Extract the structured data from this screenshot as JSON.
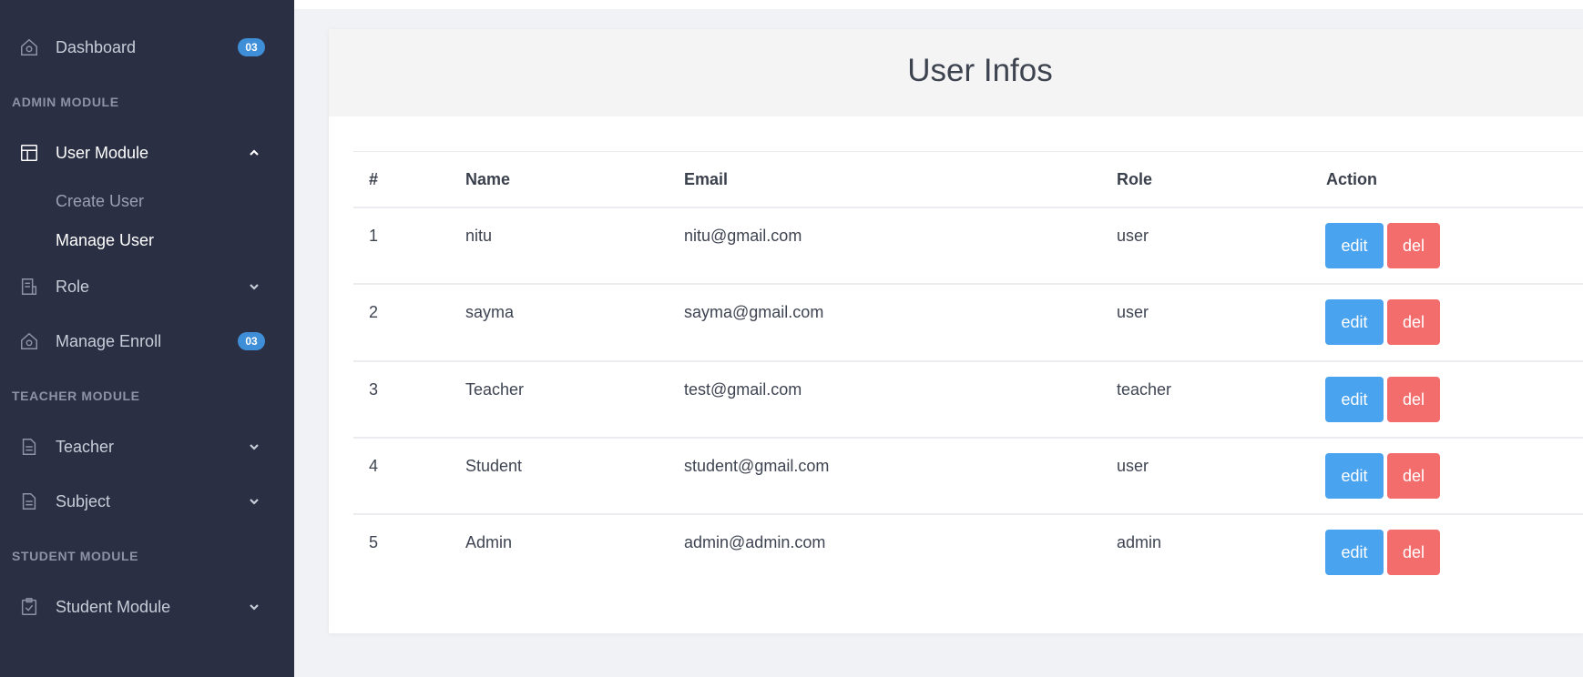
{
  "sidebar": {
    "dashboard": {
      "label": "Dashboard",
      "badge": "03",
      "icon": "home-icon"
    },
    "section_admin": "ADMIN MODULE",
    "user_module": {
      "label": "User Module",
      "icon": "layout-icon",
      "expanded": true,
      "children": [
        {
          "label": "Create User",
          "active": false
        },
        {
          "label": "Manage User",
          "active": true
        }
      ]
    },
    "role": {
      "label": "Role",
      "icon": "document-icon"
    },
    "manage_enroll": {
      "label": "Manage Enroll",
      "badge": "03",
      "icon": "home-icon"
    },
    "section_teacher": "TEACHER MODULE",
    "teacher": {
      "label": "Teacher",
      "icon": "file-icon"
    },
    "subject": {
      "label": "Subject",
      "icon": "file-icon"
    },
    "section_student": "STUDENT MODULE",
    "student_module": {
      "label": "Student Module",
      "icon": "clipboard-check-icon"
    }
  },
  "main": {
    "title": "User Infos",
    "table": {
      "headers": [
        "#",
        "Name",
        "Email",
        "Role",
        "Action"
      ],
      "rows": [
        {
          "id": "1",
          "name": "nitu",
          "email": "nitu@gmail.com",
          "role": "user"
        },
        {
          "id": "2",
          "name": "sayma",
          "email": "sayma@gmail.com",
          "role": "user"
        },
        {
          "id": "3",
          "name": "Teacher",
          "email": "test@gmail.com",
          "role": "teacher"
        },
        {
          "id": "4",
          "name": "Student",
          "email": "student@gmail.com",
          "role": "user"
        },
        {
          "id": "5",
          "name": "Admin",
          "email": "admin@admin.com",
          "role": "admin"
        }
      ],
      "edit_label": "edit",
      "delete_label": "del"
    }
  },
  "colors": {
    "sidebar_bg": "#2a2f44",
    "badge": "#3f8fd8",
    "edit_button": "#4aa3ee",
    "delete_button": "#f46d6d"
  }
}
